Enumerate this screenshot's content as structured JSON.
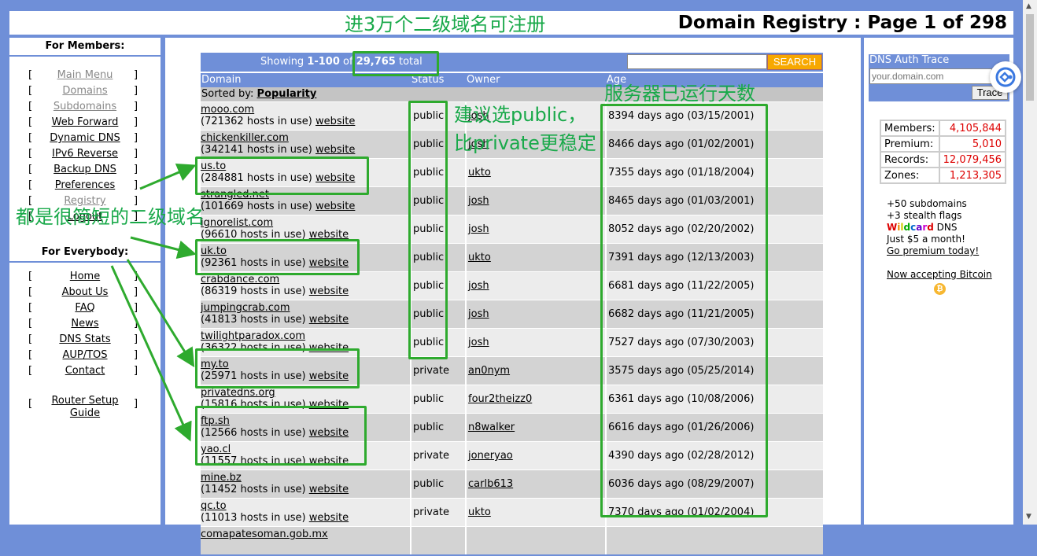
{
  "page_title": "Domain Registry : Page 1 of 298",
  "left_nav": {
    "members_heading": "For Members:",
    "members_items": [
      {
        "label": "Main Menu",
        "dim": true
      },
      {
        "label": "Domains",
        "dim": true
      },
      {
        "label": "Subdomains",
        "dim": true
      },
      {
        "label": "Web Forward",
        "dim": false
      },
      {
        "label": "Dynamic DNS",
        "dim": false
      },
      {
        "label": "IPv6 Reverse",
        "dim": false
      },
      {
        "label": "Backup DNS",
        "dim": false
      },
      {
        "label": "Preferences",
        "dim": false
      },
      {
        "label": "Registry",
        "dim": true
      },
      {
        "label": "Logout",
        "dim": false
      }
    ],
    "everybody_heading": "For Everybody:",
    "everybody_items": [
      "Home",
      "About Us",
      "FAQ",
      "News",
      "DNS Stats",
      "AUP/TOS",
      "Contact"
    ],
    "router_line1": "Router Setup",
    "router_line2": "Guide",
    "bracket_left": "[",
    "bracket_right": "]"
  },
  "table": {
    "showing_prefix": "Showing ",
    "showing_range": "1-100",
    "showing_of": " of ",
    "showing_total": "29,765",
    "showing_suffix": " total",
    "search_label": "SEARCH",
    "search_value": "",
    "columns": [
      "Domain",
      "Status",
      "Owner",
      "Age"
    ],
    "sorted_by_label": "Sorted by: ",
    "sorted_by_value": "Popularity",
    "rows": [
      {
        "domain": "mooo.com",
        "hosts": "(721362 hosts in use)",
        "site": "website",
        "status": "public",
        "owner": "josh",
        "age": "8394 days ago (03/15/2001)"
      },
      {
        "domain": "chickenkiller.com",
        "hosts": "(342141 hosts in use)",
        "site": "website",
        "status": "public",
        "owner": "josh",
        "age": "8466 days ago (01/02/2001)"
      },
      {
        "domain": "us.to",
        "hosts": "(284881 hosts in use)",
        "site": "website",
        "status": "public",
        "owner": "ukto",
        "age": "7355 days ago (01/18/2004)"
      },
      {
        "domain": "strangled.net",
        "hosts": "(101669 hosts in use)",
        "site": "website",
        "status": "public",
        "owner": "josh",
        "age": "8465 days ago (01/03/2001)"
      },
      {
        "domain": "ignorelist.com",
        "hosts": "(96610 hosts in use)",
        "site": "website",
        "status": "public",
        "owner": "josh",
        "age": "8052 days ago (02/20/2002)"
      },
      {
        "domain": "uk.to",
        "hosts": "(92361 hosts in use)",
        "site": "website",
        "status": "public",
        "owner": "ukto",
        "age": "7391 days ago (12/13/2003)"
      },
      {
        "domain": "crabdance.com",
        "hosts": "(86319 hosts in use)",
        "site": "website",
        "status": "public",
        "owner": "josh",
        "age": "6681 days ago (11/22/2005)"
      },
      {
        "domain": "jumpingcrab.com",
        "hosts": "(41813 hosts in use)",
        "site": "website",
        "status": "public",
        "owner": "josh",
        "age": "6682 days ago (11/21/2005)"
      },
      {
        "domain": "twilightparadox.com",
        "hosts": "(36322 hosts in use)",
        "site": "website",
        "status": "public",
        "owner": "josh",
        "age": "7527 days ago (07/30/2003)"
      },
      {
        "domain": "my.to",
        "hosts": "(25971 hosts in use)",
        "site": "website",
        "status": "private",
        "owner": "an0nym",
        "age": "3575 days ago (05/25/2014)"
      },
      {
        "domain": "privatedns.org",
        "hosts": "(15816 hosts in use)",
        "site": "website",
        "status": "public",
        "owner": "four2theizz0",
        "age": "6361 days ago (10/08/2006)"
      },
      {
        "domain": "ftp.sh",
        "hosts": "(12566 hosts in use)",
        "site": "website",
        "status": "public",
        "owner": "n8walker",
        "age": "6616 days ago (01/26/2006)"
      },
      {
        "domain": "yao.cl",
        "hosts": "(11557 hosts in use)",
        "site": "website",
        "status": "private",
        "owner": "joneryao",
        "age": "4390 days ago (02/28/2012)"
      },
      {
        "domain": "mine.bz",
        "hosts": "(11452 hosts in use)",
        "site": "website",
        "status": "public",
        "owner": "carlb613",
        "age": "6036 days ago (08/29/2007)"
      },
      {
        "domain": "qc.to",
        "hosts": "(11013 hosts in use)",
        "site": "website",
        "status": "private",
        "owner": "ukto",
        "age": "7370 days ago (01/02/2004)"
      },
      {
        "domain": "comapatesoman.gob.mx",
        "hosts": "",
        "site": "",
        "status": "",
        "owner": "",
        "age": ""
      }
    ]
  },
  "right_panel": {
    "dns_title": "DNS Auth Trace",
    "dns_placeholder": "your.domain.com",
    "trace_label": "Trace",
    "stats": [
      {
        "label": "Members:",
        "value": "4,105,844"
      },
      {
        "label": "Premium:",
        "value": "5,010"
      },
      {
        "label": "Records:",
        "value": "12,079,456"
      },
      {
        "label": "Zones:",
        "value": "1,213,305"
      }
    ],
    "promo_line1": "+50 subdomains",
    "promo_line2": "+3 stealth flags",
    "wildcard_word": "Wildcard",
    "wildcard_suffix": " DNS",
    "promo_line4": "Just $5 a month!",
    "promo_link": "Go premium today!",
    "bitcoin_text": "Now accepting Bitcoin",
    "bitcoin_symbol": "₿"
  },
  "annotations": {
    "top": "进3万个二级域名可注册",
    "status_note_1": "建议选public，",
    "status_note_2": "比private更稳定",
    "age_note": "服务器已运行天数",
    "short_domains": "都是很简短的二级域名"
  },
  "colors": {
    "frame_blue": "#6f8fd8",
    "annotation_green": "#19a94a",
    "stat_red": "#d00",
    "search_orange": "#f7a800"
  },
  "icons": {
    "floating_button": "assistant-logo-icon",
    "bitcoin": "bitcoin-icon"
  }
}
